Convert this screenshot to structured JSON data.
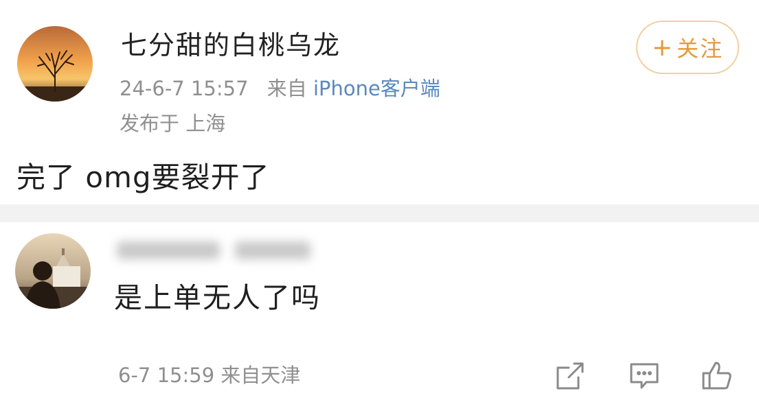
{
  "post": {
    "author_name": "七分甜的白桃乌龙",
    "timestamp": "24-6-7 15:57",
    "source_prefix": "来自",
    "source_client": "iPhone客户端",
    "location": "发布于 上海",
    "follow_plus": "+",
    "follow_label": "关注",
    "text": "完了 omg要裂开了"
  },
  "reply": {
    "text": "是上单无人了吗",
    "meta": "6-7 15:59 来自天津"
  },
  "icons": {
    "follow": "plus-icon",
    "share": "share-icon",
    "comment": "comment-icon",
    "like": "like-icon"
  },
  "colors": {
    "follow_accent": "#e39a3b",
    "follow_border": "#f2cf9c",
    "client_link": "#5a88bd",
    "meta_gray": "#8f8f8f"
  }
}
